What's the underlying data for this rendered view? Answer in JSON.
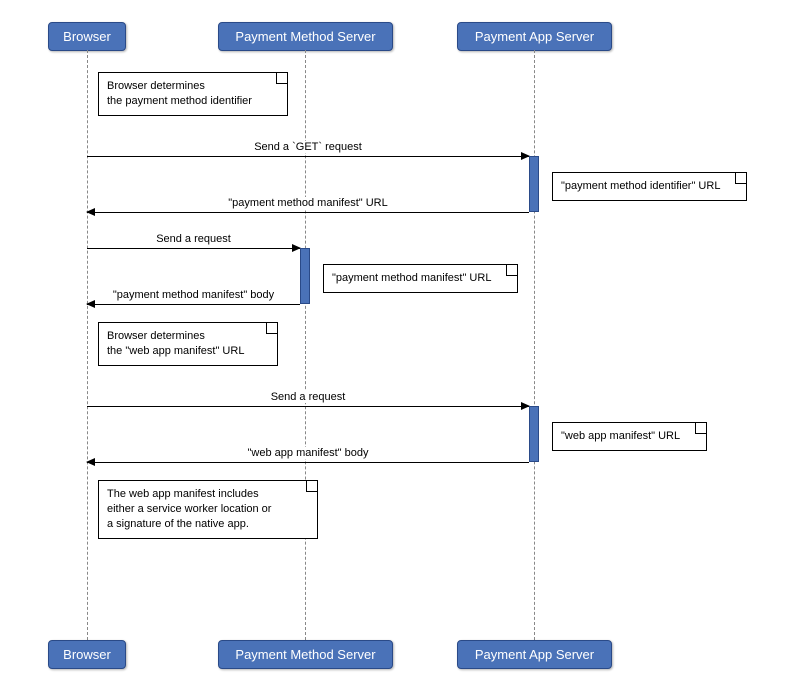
{
  "actors": {
    "browser": "Browser",
    "pms": "Payment Method Server",
    "pas": "Payment App Server"
  },
  "notes": {
    "n1a": "Browser determines",
    "n1b": "the payment method identifier",
    "n2": "\"payment method identifier\" URL",
    "n3": "\"payment method manifest\" URL",
    "n4a": "Browser determines",
    "n4b": "the \"web app manifest\" URL",
    "n5": "\"web app manifest\" URL",
    "n6a": "The web app manifest includes",
    "n6b": "either a service worker location or",
    "n6c": "a signature of the native app."
  },
  "messages": {
    "m1": "Send a `GET` request",
    "m2": "\"payment method manifest\" URL",
    "m3": "Send a request",
    "m4": "\"payment method manifest\" body",
    "m5": "Send a request",
    "m6": "\"web app manifest\" body"
  }
}
